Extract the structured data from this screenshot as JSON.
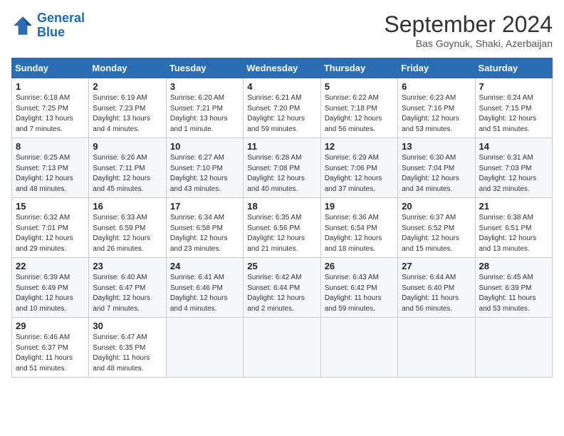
{
  "logo": {
    "line1": "General",
    "line2": "Blue"
  },
  "title": "September 2024",
  "location": "Bas Goynuk, Shaki, Azerbaijan",
  "weekdays": [
    "Sunday",
    "Monday",
    "Tuesday",
    "Wednesday",
    "Thursday",
    "Friday",
    "Saturday"
  ],
  "weeks": [
    [
      {
        "day": 1,
        "sunrise": "6:18 AM",
        "sunset": "7:25 PM",
        "daylight": "13 hours and 7 minutes."
      },
      {
        "day": 2,
        "sunrise": "6:19 AM",
        "sunset": "7:23 PM",
        "daylight": "13 hours and 4 minutes."
      },
      {
        "day": 3,
        "sunrise": "6:20 AM",
        "sunset": "7:21 PM",
        "daylight": "13 hours and 1 minute."
      },
      {
        "day": 4,
        "sunrise": "6:21 AM",
        "sunset": "7:20 PM",
        "daylight": "12 hours and 59 minutes."
      },
      {
        "day": 5,
        "sunrise": "6:22 AM",
        "sunset": "7:18 PM",
        "daylight": "12 hours and 56 minutes."
      },
      {
        "day": 6,
        "sunrise": "6:23 AM",
        "sunset": "7:16 PM",
        "daylight": "12 hours and 53 minutes."
      },
      {
        "day": 7,
        "sunrise": "6:24 AM",
        "sunset": "7:15 PM",
        "daylight": "12 hours and 51 minutes."
      }
    ],
    [
      {
        "day": 8,
        "sunrise": "6:25 AM",
        "sunset": "7:13 PM",
        "daylight": "12 hours and 48 minutes."
      },
      {
        "day": 9,
        "sunrise": "6:26 AM",
        "sunset": "7:11 PM",
        "daylight": "12 hours and 45 minutes."
      },
      {
        "day": 10,
        "sunrise": "6:27 AM",
        "sunset": "7:10 PM",
        "daylight": "12 hours and 43 minutes."
      },
      {
        "day": 11,
        "sunrise": "6:28 AM",
        "sunset": "7:08 PM",
        "daylight": "12 hours and 40 minutes."
      },
      {
        "day": 12,
        "sunrise": "6:29 AM",
        "sunset": "7:06 PM",
        "daylight": "12 hours and 37 minutes."
      },
      {
        "day": 13,
        "sunrise": "6:30 AM",
        "sunset": "7:04 PM",
        "daylight": "12 hours and 34 minutes."
      },
      {
        "day": 14,
        "sunrise": "6:31 AM",
        "sunset": "7:03 PM",
        "daylight": "12 hours and 32 minutes."
      }
    ],
    [
      {
        "day": 15,
        "sunrise": "6:32 AM",
        "sunset": "7:01 PM",
        "daylight": "12 hours and 29 minutes."
      },
      {
        "day": 16,
        "sunrise": "6:33 AM",
        "sunset": "6:59 PM",
        "daylight": "12 hours and 26 minutes."
      },
      {
        "day": 17,
        "sunrise": "6:34 AM",
        "sunset": "6:58 PM",
        "daylight": "12 hours and 23 minutes."
      },
      {
        "day": 18,
        "sunrise": "6:35 AM",
        "sunset": "6:56 PM",
        "daylight": "12 hours and 21 minutes."
      },
      {
        "day": 19,
        "sunrise": "6:36 AM",
        "sunset": "6:54 PM",
        "daylight": "12 hours and 18 minutes."
      },
      {
        "day": 20,
        "sunrise": "6:37 AM",
        "sunset": "6:52 PM",
        "daylight": "12 hours and 15 minutes."
      },
      {
        "day": 21,
        "sunrise": "6:38 AM",
        "sunset": "6:51 PM",
        "daylight": "12 hours and 13 minutes."
      }
    ],
    [
      {
        "day": 22,
        "sunrise": "6:39 AM",
        "sunset": "6:49 PM",
        "daylight": "12 hours and 10 minutes."
      },
      {
        "day": 23,
        "sunrise": "6:40 AM",
        "sunset": "6:47 PM",
        "daylight": "12 hours and 7 minutes."
      },
      {
        "day": 24,
        "sunrise": "6:41 AM",
        "sunset": "6:46 PM",
        "daylight": "12 hours and 4 minutes."
      },
      {
        "day": 25,
        "sunrise": "6:42 AM",
        "sunset": "6:44 PM",
        "daylight": "12 hours and 2 minutes."
      },
      {
        "day": 26,
        "sunrise": "6:43 AM",
        "sunset": "6:42 PM",
        "daylight": "11 hours and 59 minutes."
      },
      {
        "day": 27,
        "sunrise": "6:44 AM",
        "sunset": "6:40 PM",
        "daylight": "11 hours and 56 minutes."
      },
      {
        "day": 28,
        "sunrise": "6:45 AM",
        "sunset": "6:39 PM",
        "daylight": "11 hours and 53 minutes."
      }
    ],
    [
      {
        "day": 29,
        "sunrise": "6:46 AM",
        "sunset": "6:37 PM",
        "daylight": "11 hours and 51 minutes."
      },
      {
        "day": 30,
        "sunrise": "6:47 AM",
        "sunset": "6:35 PM",
        "daylight": "11 hours and 48 minutes."
      },
      null,
      null,
      null,
      null,
      null
    ]
  ]
}
